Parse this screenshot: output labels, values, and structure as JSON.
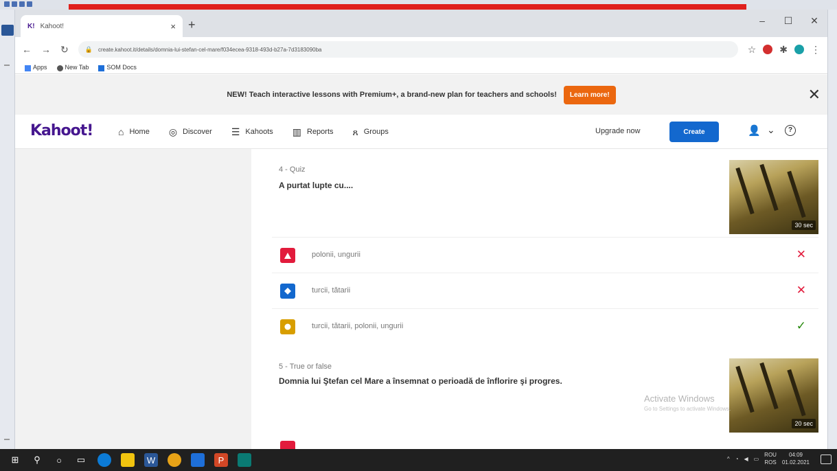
{
  "browser": {
    "tab_title": "Kahoot!",
    "tab_favicon": "K!",
    "url": "create.kahoot.it/details/domnia-lui-stefan-cel-mare/f034ecea-9318-493d-b27a-7d3183090ba",
    "bookmarks": [
      "Apps",
      "New Tab",
      "SOM Docs"
    ]
  },
  "banner": {
    "text": "NEW! Teach interactive lessons with Premium+, a brand-new plan for teachers and schools!",
    "button": "Learn more!"
  },
  "nav": {
    "logo": "Kahoot!",
    "items": [
      {
        "label": "Home",
        "icon": "home-icon",
        "glyph": "⌂"
      },
      {
        "label": "Discover",
        "icon": "compass-icon",
        "glyph": "◎"
      },
      {
        "label": "Kahoots",
        "icon": "list-icon",
        "glyph": "☰"
      },
      {
        "label": "Reports",
        "icon": "bar-chart-icon",
        "glyph": "▥"
      },
      {
        "label": "Groups",
        "icon": "groups-icon",
        "glyph": "ጸ"
      }
    ],
    "upgrade": "Upgrade now",
    "create": "Create"
  },
  "questions": [
    {
      "meta": "4 - Quiz",
      "title": "A purtat lupte cu....",
      "time": "30 sec",
      "answers": [
        {
          "text": "polonii, ungurii",
          "shape": "triangle",
          "color": "#e21b3c",
          "correct": false
        },
        {
          "text": "turcii, tătarii",
          "shape": "diamond",
          "color": "#1368ce",
          "correct": false
        },
        {
          "text": "turcii, tătarii, polonii, ungurii",
          "shape": "circle",
          "color": "#d89e00",
          "correct": true
        }
      ]
    },
    {
      "meta": "5 - True or false",
      "title": "Domnia lui Ştefan cel Mare a însemnat o perioadă de înflorire şi progres.",
      "time": "20 sec"
    }
  ],
  "watermark": {
    "title": "Activate Windows",
    "sub": "Go to Settings to activate Windows."
  },
  "taskbar": {
    "lang": "ROU",
    "lang2": "ROS",
    "time": "04:09",
    "date": "01.02.2021"
  }
}
